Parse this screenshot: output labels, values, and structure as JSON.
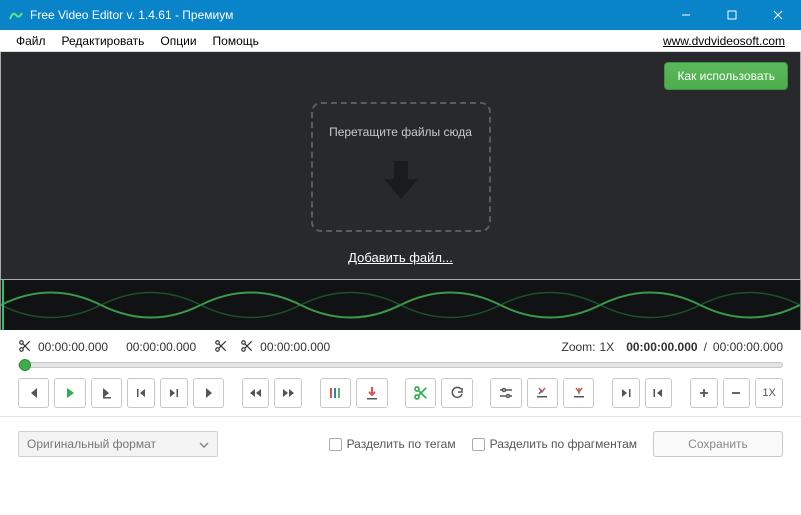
{
  "window": {
    "title": "Free Video Editor v. 1.4.61 - Премиум"
  },
  "menu": {
    "file": "Файл",
    "edit": "Редактировать",
    "options": "Опции",
    "help": "Помощь",
    "link": "www.dvdvideosoft.com"
  },
  "stage": {
    "howto": "Как использовать",
    "drophint": "Перетащите файлы сюда",
    "addfile": "Добавить файл..."
  },
  "time": {
    "cut_start": "00:00:00.000",
    "cut_end": "00:00:00.000",
    "sel": "00:00:00.000",
    "zoom_label": "Zoom:",
    "zoom_value": "1X",
    "current": "00:00:00.000",
    "sep": "/",
    "total": "00:00:00.000"
  },
  "toolbar": {
    "one_x": "1X"
  },
  "bottom": {
    "format": "Оригинальный формат",
    "by_tags": "Разделить по тегам",
    "by_fragments": "Разделить по фрагментам",
    "save": "Сохранить"
  }
}
